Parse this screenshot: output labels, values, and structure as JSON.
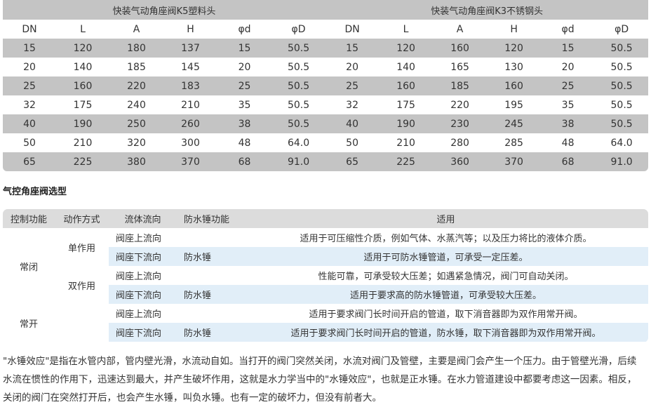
{
  "dimension_table": {
    "groups": [
      "快装气动角座阀K5塑料头",
      "快装气动角座阀K3不锈钢头"
    ],
    "headers": [
      "DN",
      "L",
      "A",
      "H",
      "φd",
      "φD",
      "DN",
      "L",
      "A",
      "H",
      "φd",
      "φD"
    ],
    "rows": [
      [
        "15",
        "120",
        "180",
        "137",
        "15",
        "50.5",
        "15",
        "120",
        "160",
        "120",
        "15",
        "50.5"
      ],
      [
        "20",
        "140",
        "185",
        "145",
        "20",
        "50.5",
        "20",
        "140",
        "165",
        "130",
        "20",
        "50.5"
      ],
      [
        "25",
        "160",
        "220",
        "183",
        "25",
        "50.5",
        "25",
        "160",
        "185",
        "160",
        "25",
        "50.5"
      ],
      [
        "32",
        "175",
        "240",
        "210",
        "35",
        "50.5",
        "32",
        "175",
        "220",
        "195",
        "35",
        "50.5"
      ],
      [
        "40",
        "190",
        "250",
        "260",
        "38",
        "50.5",
        "40",
        "190",
        "230",
        "245",
        "38",
        "50.5"
      ],
      [
        "50",
        "210",
        "320",
        "300",
        "48",
        "64.0",
        "50",
        "210",
        "280",
        "285",
        "48",
        "64.0"
      ],
      [
        "65",
        "225",
        "380",
        "370",
        "68",
        "91.0",
        "65",
        "225",
        "360",
        "370",
        "68",
        "91.0"
      ]
    ]
  },
  "section_title": "气控角座阀选型",
  "selection_table": {
    "headers": [
      "控制功能",
      "动作方式",
      "流体流向",
      "防水锤功能",
      "适用"
    ],
    "functions": [
      "常闭",
      "常开"
    ],
    "actions": [
      "单作用",
      "双作用"
    ],
    "rows": [
      {
        "flow": "阀座上流向",
        "hammer": "",
        "use": "适用于可压缩性介质，例如气体、水蒸汽等；以及压力将比的液体介质。"
      },
      {
        "flow": "阀座下流向",
        "hammer": "防水锤",
        "use": "适用于可防水锤管道，可承受一定压差。"
      },
      {
        "flow": "阀座上流向",
        "hammer": "",
        "use": "性能可靠，可承受较大压差；如遇紧急情况，阀门可自动关闭。"
      },
      {
        "flow": "阀座下流向",
        "hammer": "防水锤",
        "use": "适用于要求高的防水锤管道，可承受较大压差。"
      },
      {
        "flow": "阀座上流向",
        "hammer": "",
        "use": "适用于要求阀门长时间开启的管道，取下消音器即为双作用常开阀。"
      },
      {
        "flow": "阀座下流向",
        "hammer": "防水锤",
        "use": "适用于要求阀门长时间开启的管道，防水锤，取下消音器即为双作用常开阀。"
      }
    ]
  },
  "paragraph": "\"水锤效应\"是指在水管内部，管内壁光滑，水流动自如。当打开的阀门突然关闭，水流对阀门及管壁，主要是阀门会产生一个压力。由于管壁光滑，后续水流在惯性的作用下，迅速达到最大，并产生破坏作用，这就是水力学当中的\"水锤效应\"，也就是正水锤。在水力管道建设中都要考虑这一因素。相反，关闭的阀门在突然打开后，也会产生水锤，叫负水锤。也有一定的破坏力，但没有前者大。"
}
